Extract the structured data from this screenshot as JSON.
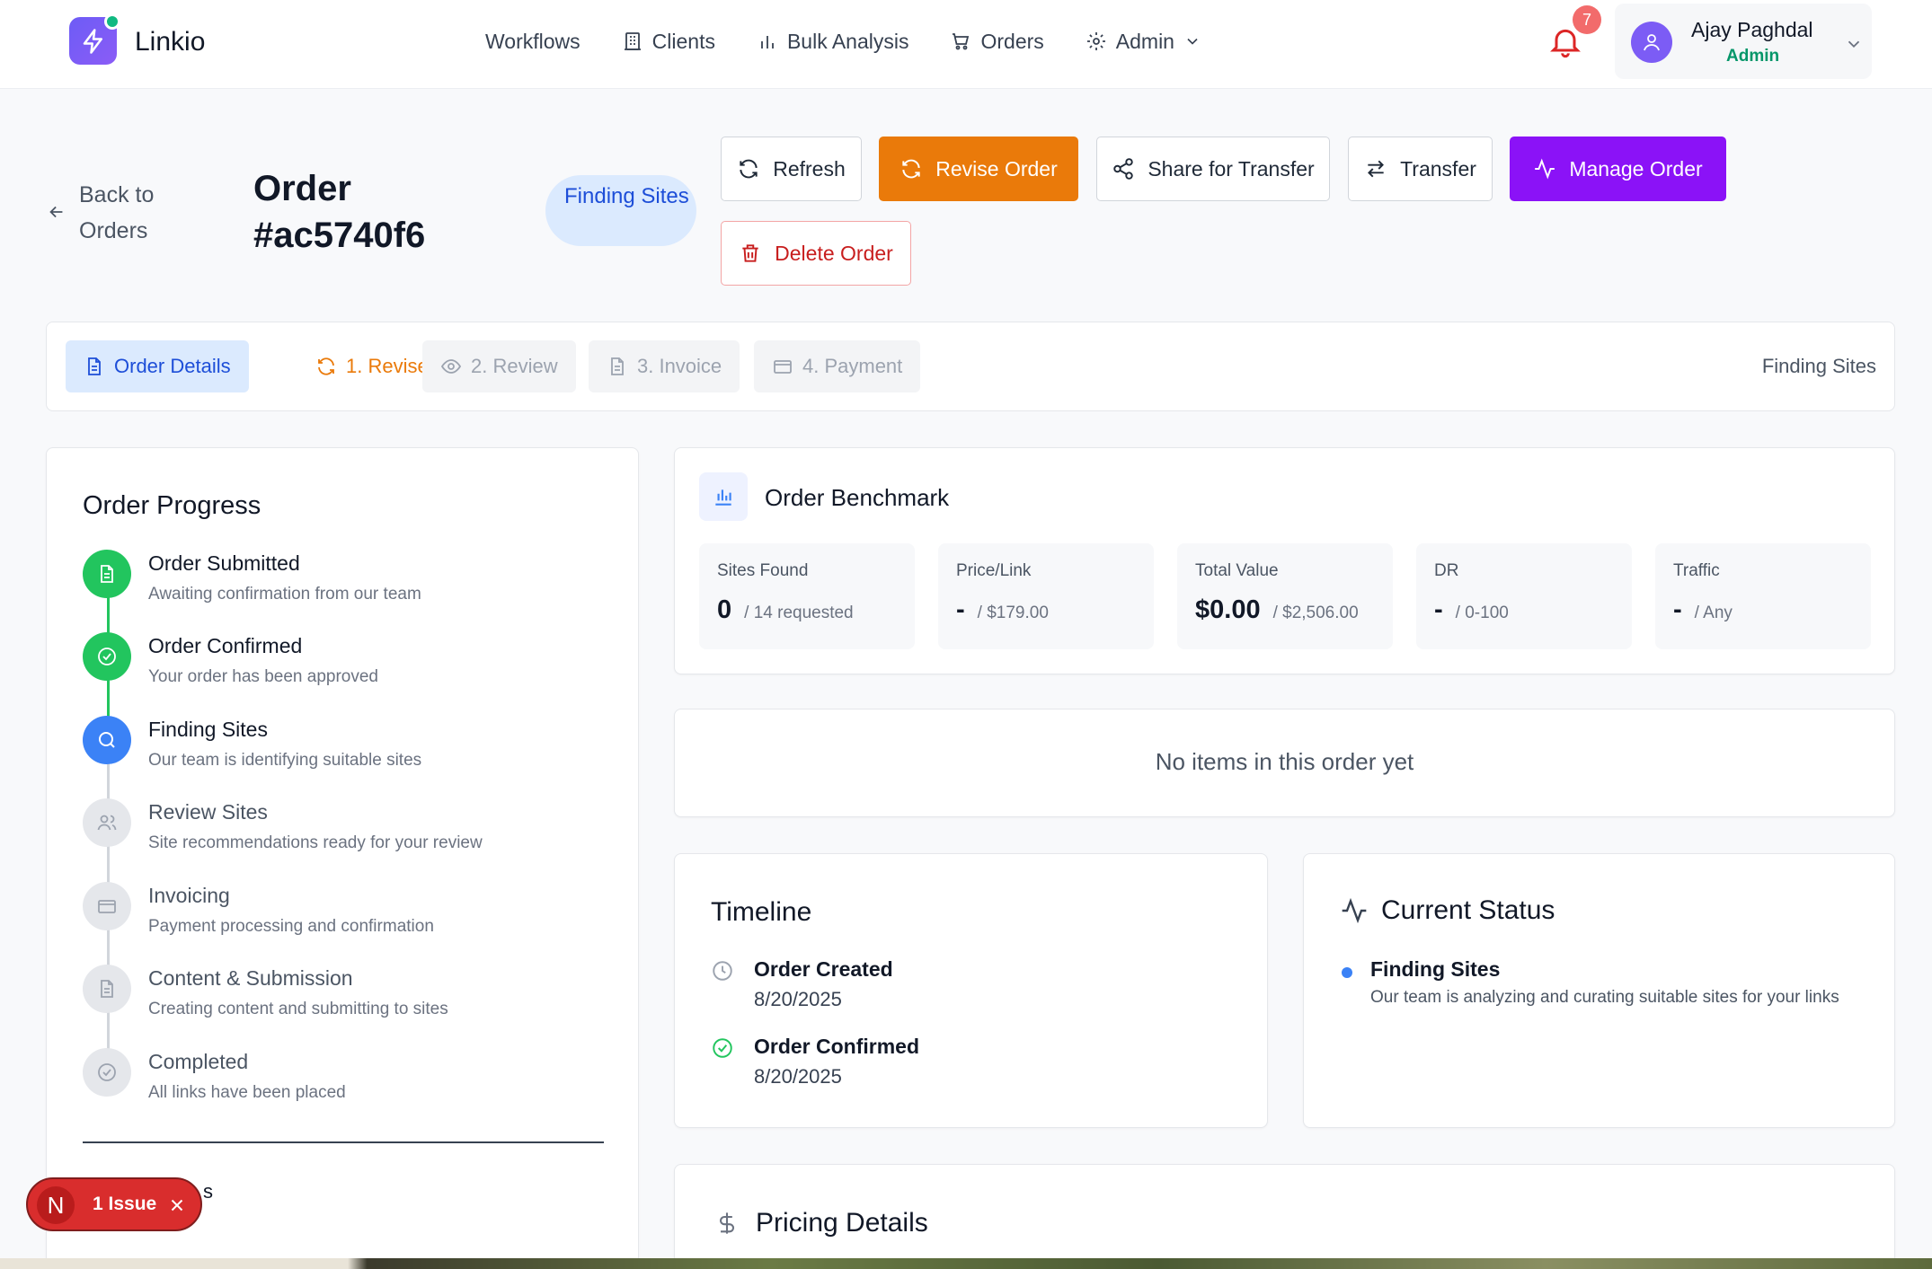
{
  "brand": {
    "name": "Linkio",
    "accent": "#6d5cf6"
  },
  "nav": {
    "items": [
      {
        "label": "Workflows",
        "icon": ""
      },
      {
        "label": "Clients",
        "icon": "building-icon"
      },
      {
        "label": "Bulk Analysis",
        "icon": "bar-chart-icon"
      },
      {
        "label": "Orders",
        "icon": "cart-icon"
      },
      {
        "label": "Admin",
        "icon": "gear-icon"
      }
    ]
  },
  "notifications": {
    "count": "7"
  },
  "user": {
    "name": "Ajay Paghdal",
    "role": "Admin"
  },
  "header": {
    "back_label": "Back to Orders",
    "order_title": "Order #ac5740f6",
    "status": "Finding Sites"
  },
  "actions": {
    "refresh": "Refresh",
    "revise": "Revise Order",
    "share": "Share for Transfer",
    "transfer": "Transfer",
    "manage": "Manage Order",
    "delete": "Delete Order",
    "revise_color": "#ea7a0a",
    "manage_color": "#8b12f7"
  },
  "tabs": {
    "items": [
      {
        "label": "Order Details",
        "state": "active"
      },
      {
        "label": "1. Revise",
        "state": "current"
      },
      {
        "label": "2. Review",
        "state": "disabled"
      },
      {
        "label": "3. Invoice",
        "state": "disabled"
      },
      {
        "label": "4. Payment",
        "state": "disabled"
      }
    ],
    "status": "Finding Sites"
  },
  "progress": {
    "title": "Order Progress",
    "steps": [
      {
        "title": "Order Submitted",
        "desc": "Awaiting confirmation from our team",
        "state": "done",
        "icon": "document-icon"
      },
      {
        "title": "Order Confirmed",
        "desc": "Your order has been approved",
        "state": "done",
        "icon": "check-circle-icon"
      },
      {
        "title": "Finding Sites",
        "desc": "Our team is identifying suitable sites",
        "state": "current",
        "icon": "search-icon"
      },
      {
        "title": "Review Sites",
        "desc": "Site recommendations ready for your review",
        "state": "pending",
        "icon": "users-icon"
      },
      {
        "title": "Invoicing",
        "desc": "Payment processing and confirmation",
        "state": "pending",
        "icon": "credit-card-icon"
      },
      {
        "title": "Content & Submission",
        "desc": "Creating content and submitting to sites",
        "state": "pending",
        "icon": "document-icon"
      },
      {
        "title": "Completed",
        "desc": "All links have been placed",
        "state": "pending",
        "icon": "check-circle-icon"
      }
    ]
  },
  "benchmark": {
    "title": "Order Benchmark",
    "metrics": [
      {
        "label": "Sites Found",
        "value": "0",
        "sub": "/ 14 requested"
      },
      {
        "label": "Price/Link",
        "value": "-",
        "sub": "/ $179.00"
      },
      {
        "label": "Total Value",
        "value": "$0.00",
        "sub": "/ $2,506.00"
      },
      {
        "label": "DR",
        "value": "-",
        "sub": "/ 0-100"
      },
      {
        "label": "Traffic",
        "value": "-",
        "sub": "/ Any"
      }
    ]
  },
  "items": {
    "empty_text": "No items in this order yet"
  },
  "timeline": {
    "title": "Timeline",
    "events": [
      {
        "title": "Order Created",
        "date": "8/20/2025",
        "icon": "clock-icon"
      },
      {
        "title": "Order Confirmed",
        "date": "8/20/2025",
        "icon": "check-circle-icon"
      }
    ]
  },
  "current_status": {
    "title": "Current Status",
    "name": "Finding Sites",
    "desc": "Our team is analyzing and curating suitable sites for your links"
  },
  "pricing": {
    "title": "Pricing Details"
  },
  "issue_badge": {
    "letter": "N",
    "label": "1 Issue",
    "peek": "s"
  }
}
